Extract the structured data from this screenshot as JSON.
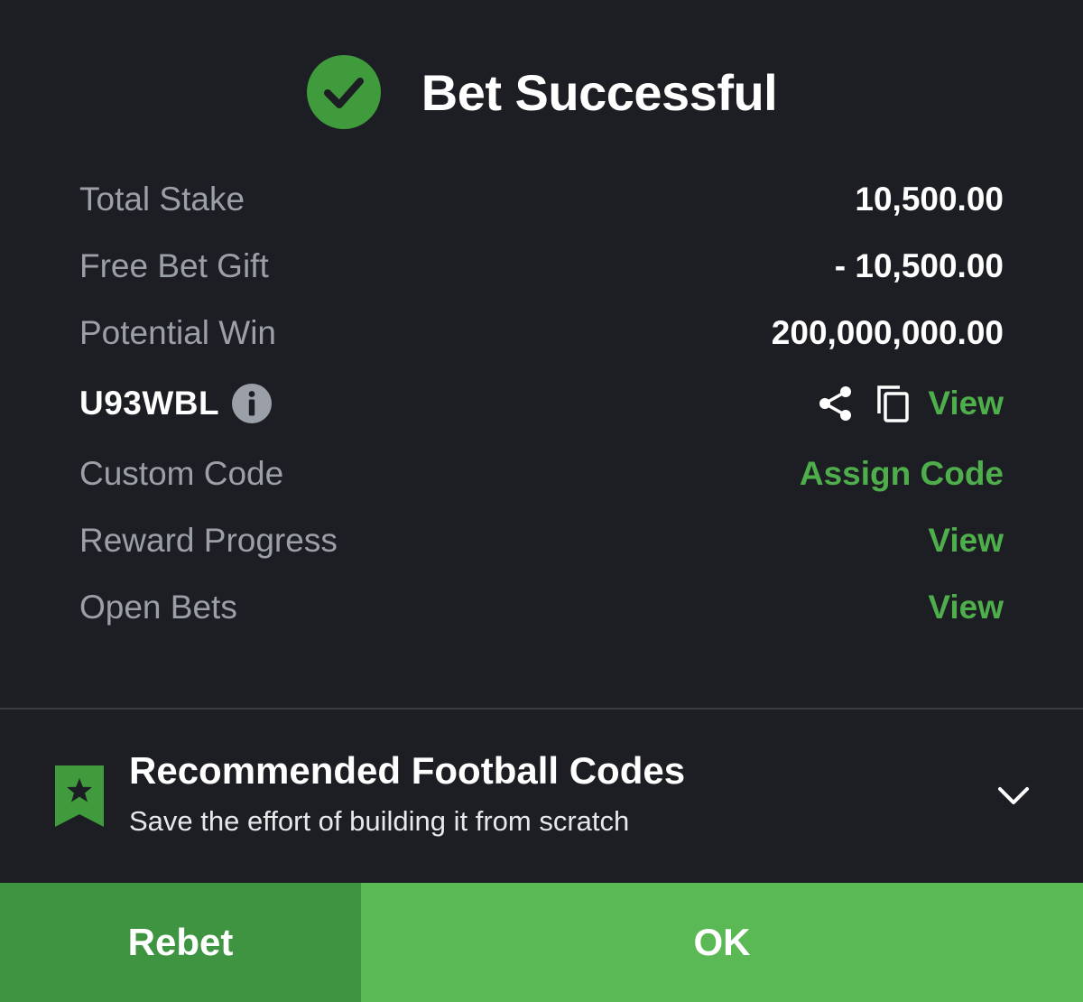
{
  "header": {
    "title": "Bet Successful",
    "icon": "check-circle-icon",
    "icon_color": "#3f9b3b"
  },
  "summary": {
    "total_stake_label": "Total Stake",
    "total_stake_value": "10,500.00",
    "free_bet_gift_label": "Free Bet Gift",
    "free_bet_gift_value": "- 10,500.00",
    "potential_win_label": "Potential Win",
    "potential_win_value": "200,000,000.00"
  },
  "booking": {
    "code": "U93WBL",
    "view_label": "View"
  },
  "custom_code": {
    "label": "Custom Code",
    "action_label": "Assign Code"
  },
  "reward_progress": {
    "label": "Reward Progress",
    "action_label": "View"
  },
  "open_bets": {
    "label": "Open Bets",
    "action_label": "View"
  },
  "recommended": {
    "title": "Recommended Football Codes",
    "subtitle": "Save the effort of building it from scratch"
  },
  "footer": {
    "rebet_label": "Rebet",
    "ok_label": "OK"
  },
  "colors": {
    "background": "#1d1e23",
    "accent_green": "#4fae4c",
    "rebet_green": "#3e9440",
    "ok_green": "#5ab955",
    "label_gray": "#9ba0a8"
  }
}
